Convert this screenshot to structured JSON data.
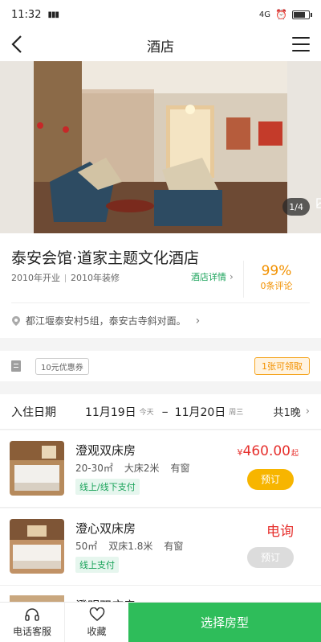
{
  "status_bar": {
    "time": "11:32",
    "signal": "4G",
    "battery_level": 0.85
  },
  "nav": {
    "title": "酒店"
  },
  "hero": {
    "photo_counter": "1/4"
  },
  "hotel": {
    "name": "泰安会馆·道家主题文化酒店",
    "opened": "2010年开业",
    "renovated": "2010年装修",
    "details_link": "酒店详情",
    "rating": "99%",
    "reviews": "0条评论",
    "address": "都江堰泰安村5组，泰安古寺斜对面。"
  },
  "coupon": {
    "tag": "10元优惠券",
    "claim": "1张可领取"
  },
  "stay": {
    "label": "入住日期",
    "checkin": "11月19日",
    "checkin_weekday": "今天",
    "dash": "–",
    "checkout": "11月20日",
    "checkout_weekday": "周三",
    "nights": "共1晚"
  },
  "rooms": [
    {
      "name": "澄观双床房",
      "area": "20-30㎡",
      "bed": "大床2米",
      "window": "有窗",
      "payment": "线上/线下支付",
      "currency": "¥",
      "price": "460.00",
      "price_suffix": "起",
      "book_label": "预订"
    },
    {
      "name": "澄心双床房",
      "area": "50㎡",
      "bed": "双床1.8米",
      "window": "有窗",
      "payment": "线上支付",
      "price_inquiry": "电询",
      "book_label": "预订"
    },
    {
      "name": "澄明双床房"
    }
  ],
  "tabbar": {
    "phone": "电话客服",
    "favorite": "收藏",
    "select": "选择房型"
  },
  "colors": {
    "accent_green": "#2ebd5a",
    "price_red": "#e6302d",
    "book_orange": "#f7b500",
    "rating_orange": "#f29100"
  }
}
